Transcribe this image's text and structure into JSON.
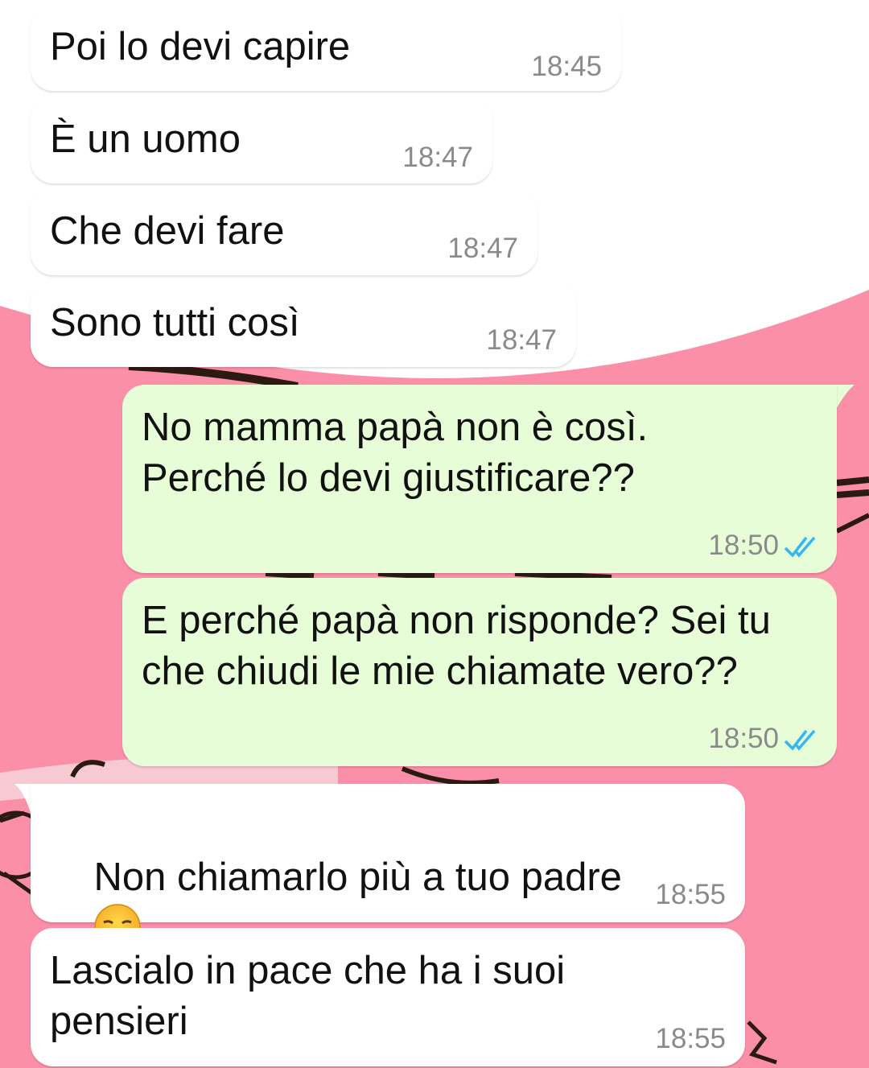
{
  "colors": {
    "incoming_bubble": "#ffffff",
    "outgoing_bubble": "#e6fdd8",
    "wallpaper_pink": "#fa8fa7",
    "read_tick": "#34b7f1",
    "timestamp": "#8a8a8a"
  },
  "messages": [
    {
      "direction": "incoming",
      "text": "Poi lo devi capire",
      "time": "18:45"
    },
    {
      "direction": "incoming",
      "text": "È un uomo",
      "time": "18:47"
    },
    {
      "direction": "incoming",
      "text": "Che devi fare",
      "time": "18:47"
    },
    {
      "direction": "incoming",
      "text": "Sono tutti così",
      "time": "18:47"
    },
    {
      "direction": "outgoing",
      "text": "No mamma papà non è così.\nPerché lo devi giustificare??",
      "time": "18:50",
      "status_icon": "double-check-read-icon"
    },
    {
      "direction": "outgoing",
      "text": "E perché papà non risponde? Sei tu\nche chiudi le mie chiamate vero??",
      "time": "18:50",
      "status_icon": "double-check-read-icon"
    },
    {
      "direction": "incoming",
      "text": "Non chiamarlo più a tuo padre",
      "emoji": "pensive-face-icon",
      "time": "18:55"
    },
    {
      "direction": "incoming",
      "text": "Lascialo in pace che ha i suoi\npensieri",
      "time": "18:55"
    }
  ]
}
